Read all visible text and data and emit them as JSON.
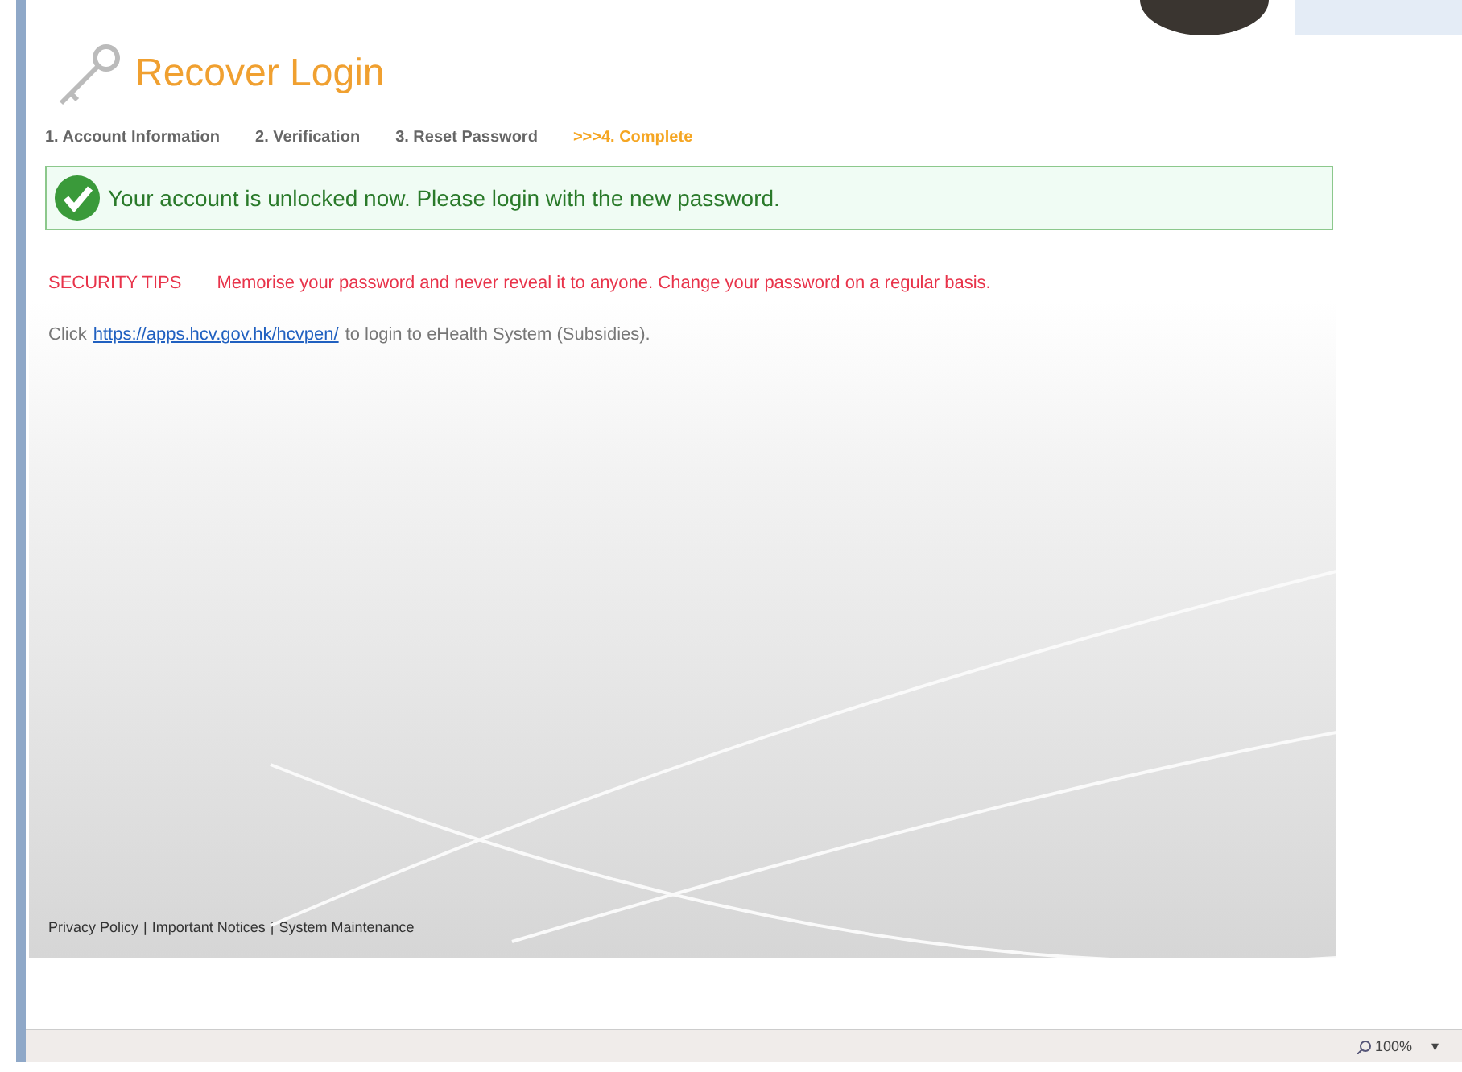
{
  "page": {
    "title": "Recover Login"
  },
  "steps": [
    {
      "label": "1. Account Information",
      "selected": false
    },
    {
      "label": "2. Verification",
      "selected": false
    },
    {
      "label": "3. Reset Password",
      "selected": false
    },
    {
      "label": ">>>4. Complete",
      "selected": true
    }
  ],
  "message": {
    "text": "Your account is unlocked now. Please login with the new password."
  },
  "security_tips": {
    "label": "SECURITY TIPS",
    "text": "Memorise your password and never reveal it to anyone. Change your password on a regular basis."
  },
  "login_line": {
    "before": "Click",
    "link": "https://apps.hcv.gov.hk/hcvpen/",
    "after": "to login to eHealth System (Subsidies)."
  },
  "footer": {
    "links": [
      "Privacy Policy",
      "Important Notices",
      "System Maintenance"
    ],
    "separator": "|"
  },
  "status_bar": {
    "zoom": "100%",
    "dropdown": "▾"
  }
}
